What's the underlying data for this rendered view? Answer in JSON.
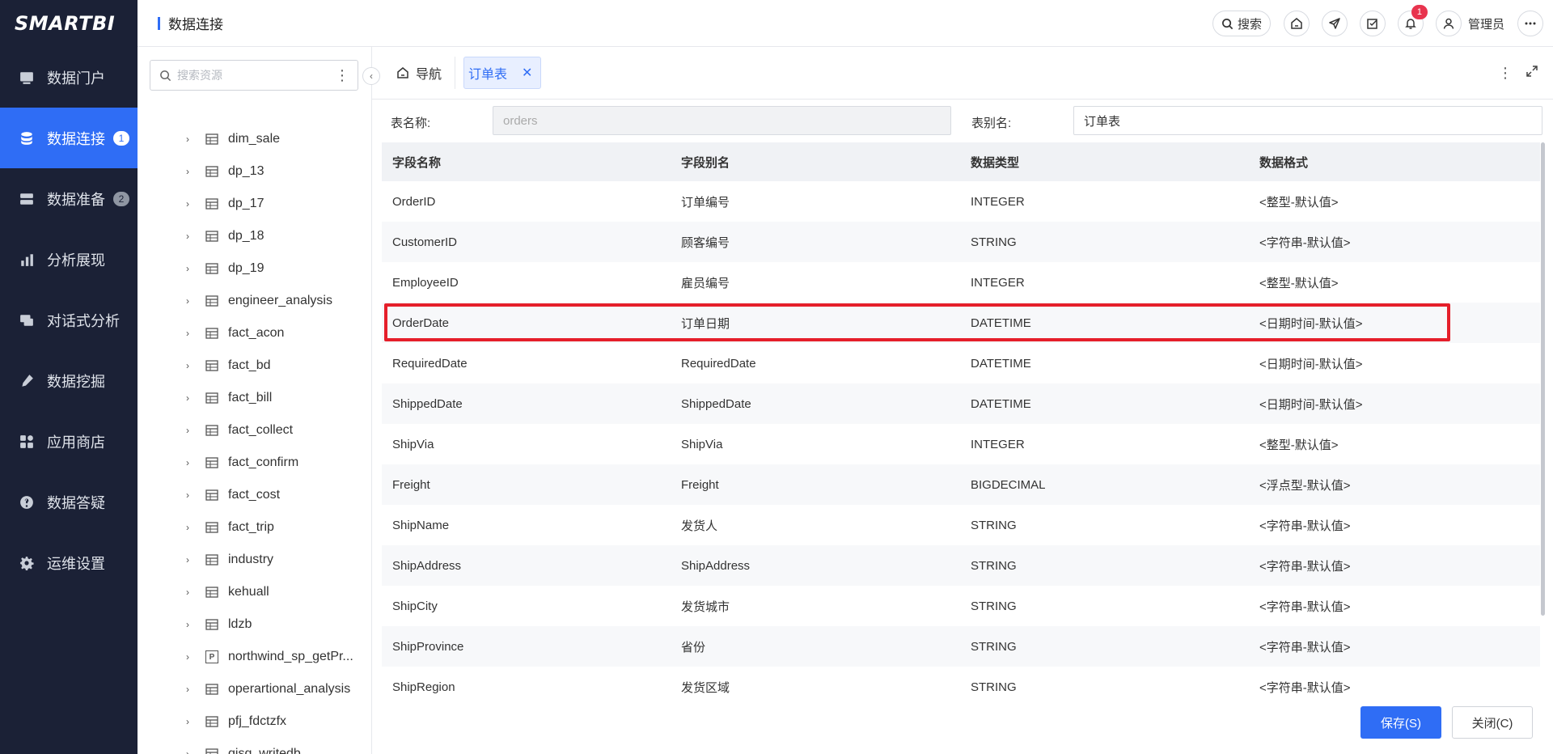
{
  "app": {
    "logo": "SMARTBI",
    "page_title": "数据连接"
  },
  "nav": [
    {
      "label": "数据门户",
      "icon": "monitor-icon"
    },
    {
      "label": "数据连接",
      "icon": "database-icon",
      "badge": "1",
      "active": true
    },
    {
      "label": "数据准备",
      "icon": "server-icon",
      "badge": "2"
    },
    {
      "label": "分析展现",
      "icon": "bar-chart-icon"
    },
    {
      "label": "对话式分析",
      "icon": "chat-icon"
    },
    {
      "label": "数据挖掘",
      "icon": "pick-icon"
    },
    {
      "label": "应用商店",
      "icon": "app-grid-icon"
    },
    {
      "label": "数据答疑",
      "icon": "question-icon"
    },
    {
      "label": "运维设置",
      "icon": "gear-icon"
    }
  ],
  "header": {
    "search_label": "搜索",
    "notification_count": "1",
    "user_name": "管理员"
  },
  "tree": {
    "search_placeholder": "搜索资源",
    "items": [
      {
        "label": "dim_sale",
        "type": "table"
      },
      {
        "label": "dp_13",
        "type": "table"
      },
      {
        "label": "dp_17",
        "type": "table"
      },
      {
        "label": "dp_18",
        "type": "table"
      },
      {
        "label": "dp_19",
        "type": "table"
      },
      {
        "label": "engineer_analysis",
        "type": "table"
      },
      {
        "label": "fact_acon",
        "type": "table"
      },
      {
        "label": "fact_bd",
        "type": "table"
      },
      {
        "label": "fact_bill",
        "type": "table"
      },
      {
        "label": "fact_collect",
        "type": "table"
      },
      {
        "label": "fact_confirm",
        "type": "table"
      },
      {
        "label": "fact_cost",
        "type": "table"
      },
      {
        "label": "fact_trip",
        "type": "table"
      },
      {
        "label": "industry",
        "type": "table"
      },
      {
        "label": "kehuall",
        "type": "table"
      },
      {
        "label": "ldzb",
        "type": "table"
      },
      {
        "label": "northwind_sp_getPr...",
        "type": "procedure"
      },
      {
        "label": "operartional_analysis",
        "type": "table"
      },
      {
        "label": "pfj_fdctzfx",
        "type": "table"
      },
      {
        "label": "qisq_writedb",
        "type": "table"
      }
    ]
  },
  "tabs": {
    "nav_label": "导航",
    "active_label": "订单表"
  },
  "form": {
    "table_name_label": "表名称:",
    "table_name_value": "orders",
    "alias_label": "表别名:",
    "alias_value": "订单表"
  },
  "table": {
    "columns": [
      "字段名称",
      "字段别名",
      "数据类型",
      "数据格式"
    ],
    "rows": [
      [
        "OrderID",
        "订单编号",
        "INTEGER",
        "<整型-默认值>"
      ],
      [
        "CustomerID",
        "顾客编号",
        "STRING",
        "<字符串-默认值>"
      ],
      [
        "EmployeeID",
        "雇员编号",
        "INTEGER",
        "<整型-默认值>"
      ],
      [
        "OrderDate",
        "订单日期",
        "DATETIME",
        "<日期时间-默认值>"
      ],
      [
        "RequiredDate",
        "RequiredDate",
        "DATETIME",
        "<日期时间-默认值>"
      ],
      [
        "ShippedDate",
        "ShippedDate",
        "DATETIME",
        "<日期时间-默认值>"
      ],
      [
        "ShipVia",
        "ShipVia",
        "INTEGER",
        "<整型-默认值>"
      ],
      [
        "Freight",
        "Freight",
        "BIGDECIMAL",
        "<浮点型-默认值>"
      ],
      [
        "ShipName",
        "发货人",
        "STRING",
        "<字符串-默认值>"
      ],
      [
        "ShipAddress",
        "ShipAddress",
        "STRING",
        "<字符串-默认值>"
      ],
      [
        "ShipCity",
        "发货城市",
        "STRING",
        "<字符串-默认值>"
      ],
      [
        "ShipProvince",
        "省份",
        "STRING",
        "<字符串-默认值>"
      ],
      [
        "ShipRegion",
        "发货区域",
        "STRING",
        "<字符串-默认值>"
      ]
    ]
  },
  "footer": {
    "save_label": "保存(S)",
    "close_label": "关闭(C)"
  },
  "colors": {
    "primary": "#2f6df5",
    "nav_bg": "#1b2136",
    "highlight": "#e51f2a",
    "badge_red": "#e8344e"
  }
}
